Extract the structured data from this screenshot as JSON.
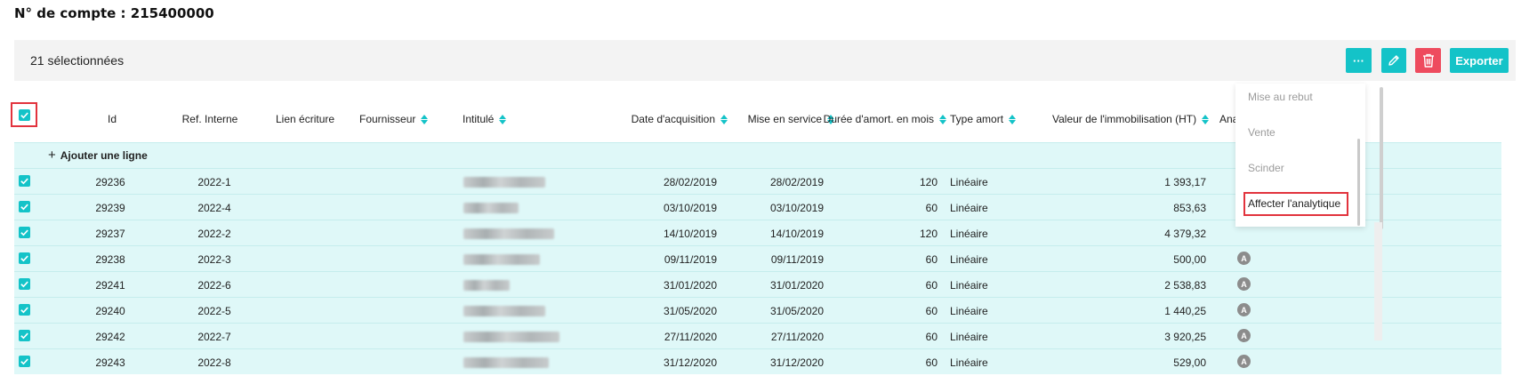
{
  "account": {
    "title": "N° de compte : 215400000"
  },
  "toolbar": {
    "selection_count": "21 sélectionnées",
    "more_label": "···",
    "edit_icon": "pencil-icon",
    "delete_icon": "trash-icon",
    "export_label": "Exporter",
    "colors": {
      "accent": "#14c3c8",
      "danger": "#ee4b5e"
    }
  },
  "table": {
    "headers": {
      "id": "Id",
      "ref": "Ref. Interne",
      "lien": "Lien écriture",
      "fournisseur": "Fournisseur",
      "intitule": "Intitulé",
      "date_acq": "Date d'acquisition",
      "mise_service": "Mise en service",
      "duree": "Durée d'amort. en mois",
      "type": "Type amort",
      "valeur": "Valeur de l'immobilisation (HT)",
      "analytique": "Ana"
    },
    "add_line_label": "Ajouter une ligne",
    "row_badge": "A",
    "rows": [
      {
        "id": "29236",
        "ref": "2022-1",
        "date_acq": "28/02/2019",
        "mise_service": "28/02/2019",
        "duree": "120",
        "type": "Linéaire",
        "valeur": "1 393,17"
      },
      {
        "id": "29239",
        "ref": "2022-4",
        "date_acq": "03/10/2019",
        "mise_service": "03/10/2019",
        "duree": "60",
        "type": "Linéaire",
        "valeur": "853,63"
      },
      {
        "id": "29237",
        "ref": "2022-2",
        "date_acq": "14/10/2019",
        "mise_service": "14/10/2019",
        "duree": "120",
        "type": "Linéaire",
        "valeur": "4 379,32"
      },
      {
        "id": "29238",
        "ref": "2022-3",
        "date_acq": "09/11/2019",
        "mise_service": "09/11/2019",
        "duree": "60",
        "type": "Linéaire",
        "valeur": "500,00"
      },
      {
        "id": "29241",
        "ref": "2022-6",
        "date_acq": "31/01/2020",
        "mise_service": "31/01/2020",
        "duree": "60",
        "type": "Linéaire",
        "valeur": "2 538,83"
      },
      {
        "id": "29240",
        "ref": "2022-5",
        "date_acq": "31/05/2020",
        "mise_service": "31/05/2020",
        "duree": "60",
        "type": "Linéaire",
        "valeur": "1 440,25"
      },
      {
        "id": "29242",
        "ref": "2022-7",
        "date_acq": "27/11/2020",
        "mise_service": "27/11/2020",
        "duree": "60",
        "type": "Linéaire",
        "valeur": "3 920,25"
      },
      {
        "id": "29243",
        "ref": "2022-8",
        "date_acq": "31/12/2020",
        "mise_service": "31/12/2020",
        "duree": "60",
        "type": "Linéaire",
        "valeur": "529,00"
      }
    ]
  },
  "dropdown": {
    "items": [
      "Mise au rebut",
      "Vente",
      "Scinder",
      "Affecter l'analytique"
    ]
  }
}
